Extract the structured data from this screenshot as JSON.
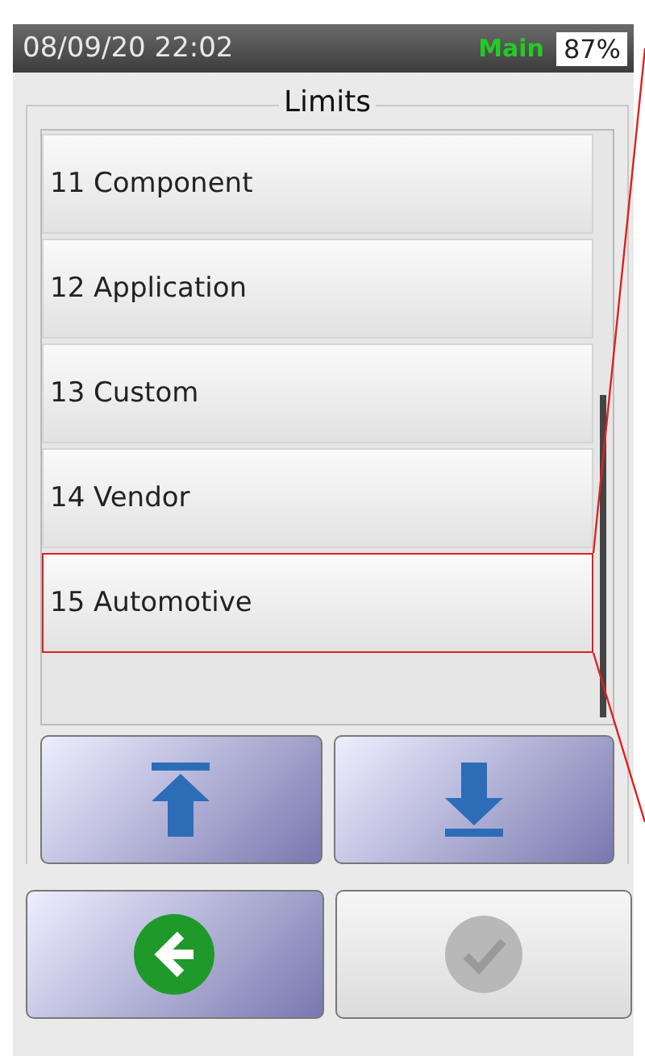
{
  "status_bar": {
    "datetime": "08/09/20 22:02",
    "mode": "Main",
    "battery": "87%"
  },
  "title": "Limits",
  "items": [
    {
      "label": "11 Component",
      "highlighted": false
    },
    {
      "label": "12 Application",
      "highlighted": false
    },
    {
      "label": "13 Custom",
      "highlighted": false
    },
    {
      "label": "14 Vendor",
      "highlighted": false
    },
    {
      "label": "15 Automotive",
      "highlighted": true
    }
  ],
  "confirm": {
    "disabled": true
  }
}
